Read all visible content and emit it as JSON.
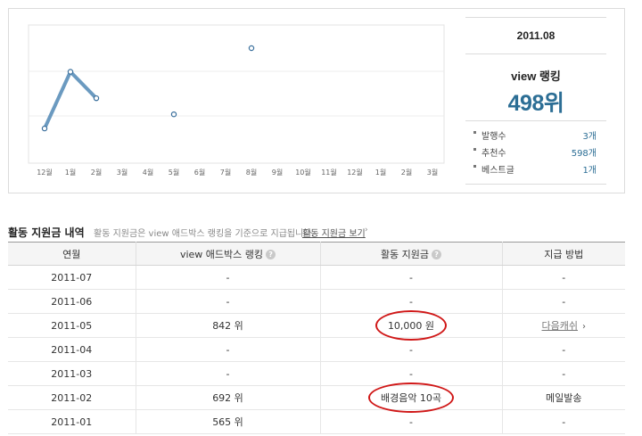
{
  "chart": {
    "months": [
      "12월",
      "1월",
      "2월",
      "3월",
      "4월",
      "5월",
      "6월",
      "7월",
      "8월",
      "9월",
      "10월",
      "11월",
      "12월",
      "1월",
      "2월",
      "3월"
    ],
    "points": [
      {
        "month_index": 0,
        "value": 0.15
      },
      {
        "month_index": 1,
        "value": 0.75
      },
      {
        "month_index": 2,
        "value": 0.47
      },
      {
        "month_index": 5,
        "value": 0.3
      },
      {
        "month_index": 8,
        "value": 1.0
      }
    ],
    "connected_through_index": 2,
    "line_color": "#5b8fb9",
    "marker_color": "#3a6f9c"
  },
  "stats": {
    "month": "2011.08",
    "rank_label": "view 랭킹",
    "rank_value": "498위",
    "rows": [
      {
        "label": "발행수",
        "value": "3개"
      },
      {
        "label": "추천수",
        "value": "598개"
      },
      {
        "label": "베스트글",
        "value": "1개"
      }
    ]
  },
  "section": {
    "title": "활동 지원금 내역",
    "description": "활동 지원금은 view 애드박스 랭킹을 기준으로 지급됩니다.",
    "link": "활동 지원금 보기",
    "link_arrow": "›"
  },
  "table": {
    "headers": [
      "연월",
      "view 애드박스 랭킹",
      "활동 지원금",
      "지급 방법"
    ],
    "rows": [
      {
        "month": "2011-07",
        "rank": "-",
        "amount": "-",
        "method": "-"
      },
      {
        "month": "2011-06",
        "rank": "-",
        "amount": "-",
        "method": "-"
      },
      {
        "month": "2011-05",
        "rank": "842 위",
        "amount": "10,000 원",
        "method": "다음캐쉬"
      },
      {
        "month": "2011-04",
        "rank": "-",
        "amount": "-",
        "method": "-"
      },
      {
        "month": "2011-03",
        "rank": "-",
        "amount": "-",
        "method": "-"
      },
      {
        "month": "2011-02",
        "rank": "692 위",
        "amount": "배경음악 10곡",
        "method": "메일발송"
      },
      {
        "month": "2011-01",
        "rank": "565 위",
        "amount": "-",
        "method": "-"
      }
    ],
    "help_glyph": "?",
    "pay_arrow": "›"
  }
}
